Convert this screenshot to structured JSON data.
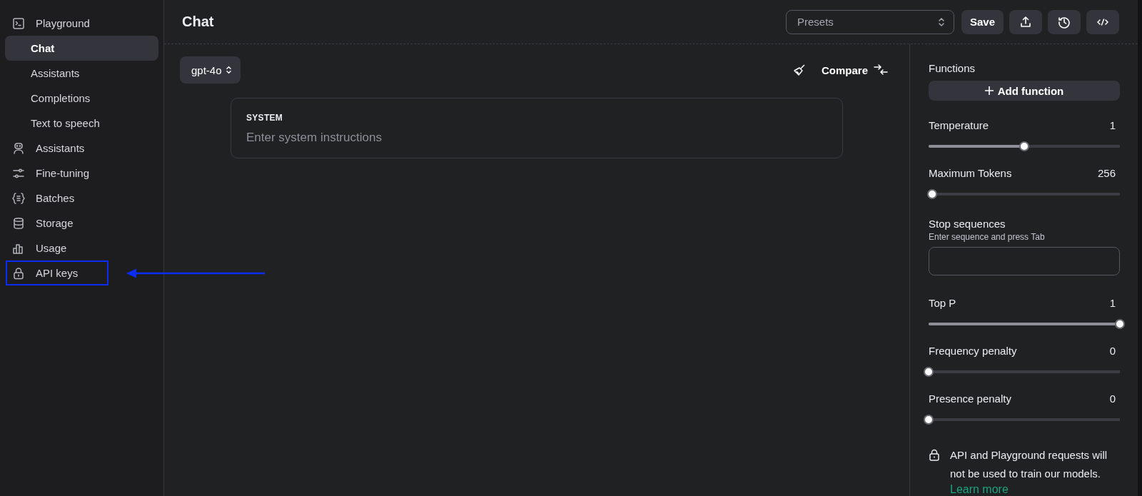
{
  "sidebar": {
    "items": [
      {
        "label": "Playground",
        "selected": false,
        "highlighted": false,
        "children": [
          {
            "label": "Chat",
            "selected": true
          },
          {
            "label": "Assistants",
            "selected": false
          },
          {
            "label": "Completions",
            "selected": false
          },
          {
            "label": "Text to speech",
            "selected": false
          }
        ]
      },
      {
        "label": "Assistants",
        "selected": false,
        "highlighted": false
      },
      {
        "label": "Fine-tuning",
        "selected": false,
        "highlighted": false
      },
      {
        "label": "Batches",
        "selected": false,
        "highlighted": false
      },
      {
        "label": "Storage",
        "selected": false,
        "highlighted": false
      },
      {
        "label": "Usage",
        "selected": false,
        "highlighted": false
      },
      {
        "label": "API keys",
        "selected": false,
        "highlighted": true
      }
    ]
  },
  "header": {
    "title": "Chat",
    "presets": {
      "placeholder": "Presets"
    },
    "save": "Save"
  },
  "chat": {
    "model": "gpt-4o",
    "compare": "Compare",
    "system": {
      "label": "SYSTEM",
      "placeholder": "Enter system instructions"
    }
  },
  "settings": {
    "functions": {
      "label": "Functions",
      "button": "Add function"
    },
    "params": [
      {
        "kind": "slider",
        "label": "Temperature",
        "reading": "1",
        "level": 0.5
      },
      {
        "kind": "slider",
        "label": "Maximum Tokens",
        "reading": "256",
        "level": 0.02
      },
      {
        "kind": "text",
        "label": "Stop sequences",
        "hint": "Enter sequence and press Tab"
      },
      {
        "kind": "slider",
        "label": "Top P",
        "reading": "1",
        "level": 1
      },
      {
        "kind": "slider",
        "label": "Frequency penalty",
        "reading": "0",
        "level": 0
      },
      {
        "kind": "slider",
        "label": "Presence penalty",
        "reading": "0",
        "level": 0
      }
    ],
    "notice": {
      "text": "API and Playground requests will not be used to train our models.",
      "link": "Learn more"
    }
  }
}
